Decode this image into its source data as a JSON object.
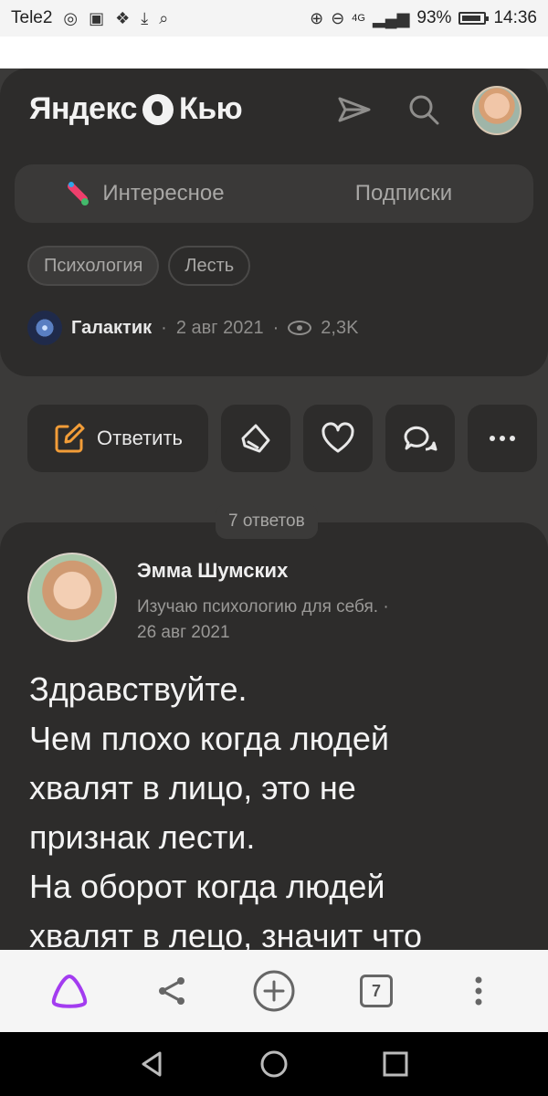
{
  "status_bar": {
    "carrier": "Tele2",
    "network": "4G",
    "battery": "93%",
    "time": "14:36"
  },
  "header": {
    "logo_text_left": "Яндекс",
    "logo_text_right": "Кью",
    "icons": [
      "send-icon",
      "search-icon",
      "user-avatar"
    ]
  },
  "tabs": [
    {
      "label": "Интересное",
      "icon": "interesting-icon"
    },
    {
      "label": "Подписки"
    }
  ],
  "question": {
    "tags": [
      "Психология",
      "Лесть"
    ],
    "author": "Галактик",
    "date": "2 авг 2021",
    "views": "2,3K"
  },
  "actions": {
    "reply_label": "Ответить",
    "buttons": [
      "upvote-icon",
      "heart-icon",
      "comments-icon",
      "more-icon"
    ]
  },
  "answers_count": "7 ответов",
  "answer": {
    "author": "Эмма Шумских",
    "bio": "Изучаю психологию для себя.",
    "date": "26 авг 2021",
    "text_lines": [
      "Здравствуйте.",
      "Чем плохо когда людей",
      "хвалят в лицо, это не",
      "признак лести.",
      "На оборот когда людей",
      "хвалят в лецо, значит что"
    ]
  },
  "bottom_bar": {
    "tabs_count": "7",
    "icons": [
      "alice-icon",
      "share-icon",
      "add-icon",
      "tabs-icon",
      "menu-dots-icon"
    ]
  },
  "colors": {
    "background": "#3b3a39",
    "card": "#2d2c2b",
    "accent_orange": "#f29d38",
    "alice_purple": "#a33cf0"
  }
}
